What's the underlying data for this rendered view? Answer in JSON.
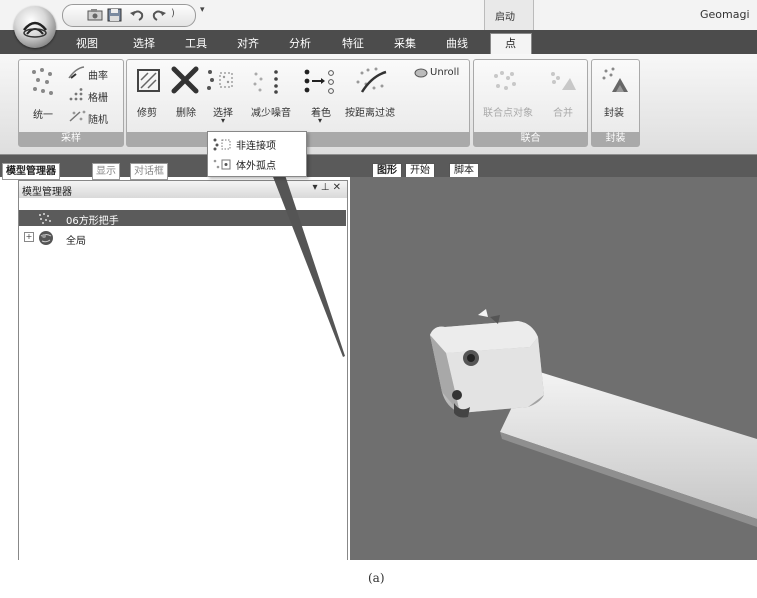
{
  "titlebar": {
    "app_title": "Geomagi",
    "context_group": "启动",
    "qat_icons": [
      "capture-icon",
      "save-icon",
      "undo-icon",
      "redo-icon"
    ]
  },
  "ribbon_tabs": [
    "视图",
    "选择",
    "工具",
    "对齐",
    "分析",
    "特征",
    "采集",
    "曲线",
    "点"
  ],
  "active_tab": "点",
  "groups": {
    "sampling": {
      "label": "采样",
      "uniform": "统一",
      "curvature": "曲率",
      "grid": "格栅",
      "random": "随机"
    },
    "points": {
      "trim": "修剪",
      "delete": "删除",
      "select": "选择",
      "reduce_noise": "减少噪音",
      "color": "着色",
      "distance_filter": "按距离过滤",
      "unroll": "Unroll"
    },
    "union": {
      "label": "联合",
      "union_objects": "联合点对象",
      "merge": "合并"
    },
    "wrap": {
      "label": "封装",
      "wrap": "封装"
    }
  },
  "select_menu": {
    "items": [
      "非连接项",
      "体外孤点"
    ]
  },
  "panel_tabs": [
    "模型管理器",
    "显示",
    "对话框"
  ],
  "viewport_tabs": [
    "图形",
    "开始",
    "脚本"
  ],
  "model_manager": {
    "title": "模型管理器",
    "pin_glyph": "▾ ⊥ ✕",
    "tree": [
      {
        "label": "06方形把手",
        "selected": true
      },
      {
        "label": "全局",
        "selected": false
      }
    ]
  },
  "caption": "(a)",
  "colors": {
    "tab_strip": "#4c4c4c",
    "group_label_bg": "#a9a9a9",
    "viewport_bg": "#6f6f6f",
    "selection_bg": "#5b5b5b"
  }
}
